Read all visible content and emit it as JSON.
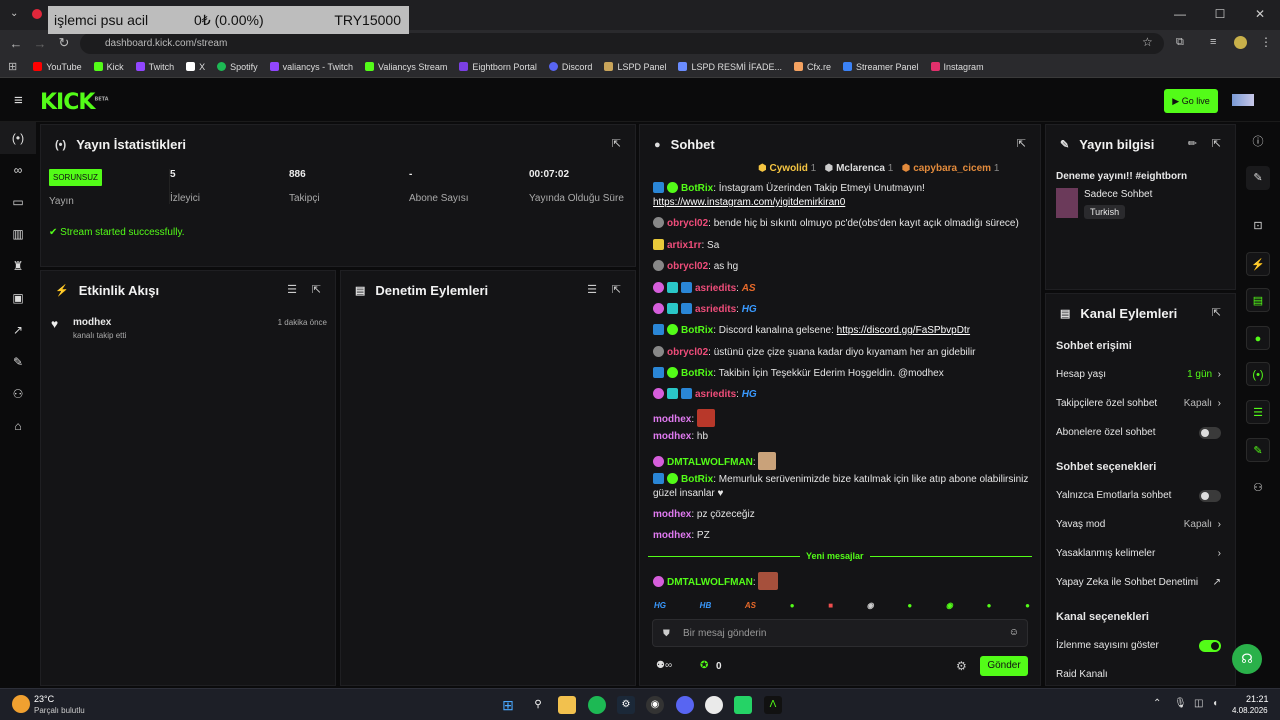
{
  "browser": {
    "donation_overlay": {
      "message": "işlemci psu acil",
      "amount": "0₺ (0.00%)",
      "goal": "TRY15000"
    },
    "url": "dashboard.kick.com/stream",
    "bookmarks": [
      "YouTube",
      "Kick",
      "Twitch",
      "X",
      "Spotify",
      "valiancys - Twitch",
      "Valiancys Stream",
      "Eightborn Portal",
      "Discord",
      "LSPD Panel",
      "LSPD  RESMİ İFADE...",
      "Cfx.re",
      "Streamer Panel",
      "Instagram"
    ],
    "bookmark_colors": [
      "#ff0000",
      "#53fc18",
      "#9146ff",
      "#ffffff",
      "#1db954",
      "#9146ff",
      "#53fc18",
      "#7b3fe4",
      "#5865f2",
      "#c8a45a",
      "#6a8cff",
      "#f4a261",
      "#3b82f6",
      "#e1306c"
    ]
  },
  "header": {
    "logo": "KICK",
    "beta": "BETA",
    "go_live": "Go live"
  },
  "stats": {
    "title": "Yayın İstatistikleri",
    "status_badge": "SORUNSUZ",
    "items": [
      {
        "value": "",
        "label": "Yayın"
      },
      {
        "value": "5",
        "label": "İzleyici"
      },
      {
        "value": "886",
        "label": "Takipçi"
      },
      {
        "value": "-",
        "label": "Abone Sayısı"
      },
      {
        "value": "00:07:02",
        "label": "Yayında Olduğu Süre"
      }
    ],
    "success": "Stream started successfully."
  },
  "activity": {
    "title": "Etkinlik Akışı",
    "user": "modhex",
    "action": "kanalı takip etti",
    "time": "1 dakika önce"
  },
  "moderation": {
    "title": "Denetim Eylemleri"
  },
  "chat": {
    "title": "Sohbet",
    "top_gifters": [
      {
        "name": "Cywolid",
        "count": "1"
      },
      {
        "name": "Mclarenca",
        "count": "1"
      },
      {
        "name": "capybara_cicem",
        "count": "1"
      }
    ],
    "messages": [
      {
        "user": "BotRix",
        "text": "İnstagram Üzerinden Takip Etmeyi Unutmayın!",
        "line2": "https://www.instagram.com/yigitdemirkiran0"
      },
      {
        "user": "obrycl02",
        "text": "bende hiç bi sıkıntı olmuyo pc'de(obs'den kayıt açık olmadığı sürece)"
      },
      {
        "user": "artix1rr",
        "text": "Sa"
      },
      {
        "user": "obrycl02",
        "text": "as hg"
      },
      {
        "user": "asriedits",
        "text": "AS"
      },
      {
        "user": "asriedits",
        "text": "HG"
      },
      {
        "user": "BotRix",
        "text": "Discord kanalına gelsene: ",
        "link": "https://discord.gg/FaSPbvpDtr"
      },
      {
        "user": "obrycl02",
        "text": "üstünü çize çize şuana kadar diyo kıyamam her an gidebilir"
      },
      {
        "user": "BotRix",
        "text": "Takibin İçin Teşekkür Ederim Hoşgeldin. @modhex"
      },
      {
        "user": "asriedits",
        "text": "HG"
      },
      {
        "user": "modhex",
        "text": ""
      },
      {
        "user": "modhex",
        "text": "hb"
      },
      {
        "user": "DMTALWOLFMAN",
        "text": ""
      },
      {
        "user": "BotRix",
        "text": "Memurluk serüvenimizde bize katılmak için like atıp abone olabilirsiniz",
        "line2": "güzel insanlar ♥"
      },
      {
        "user": "modhex",
        "text": "pz çözeceğiz"
      },
      {
        "user": "modhex",
        "text": "PZ"
      },
      {
        "user": "DMTALWOLFMAN",
        "text": ""
      }
    ],
    "new_messages": "Yeni mesajlar",
    "emote_row": [
      "HG",
      "HB",
      "AS"
    ],
    "placeholder": "Bir mesaj gönderin",
    "points": "0",
    "send": "Gönder"
  },
  "stream_info": {
    "title": "Yayın bilgisi",
    "stream_title": "Deneme yayını!! #eightborn",
    "category": "Sadece Sohbet",
    "tag": "Turkish"
  },
  "channel_actions": {
    "title": "Kanal Eylemleri",
    "chat_access": "Sohbet erişimi",
    "account_age": {
      "label": "Hesap yaşı",
      "value": "1 gün"
    },
    "followers_only": {
      "label": "Takipçilere özel sohbet",
      "value": "Kapalı"
    },
    "subs_only": {
      "label": "Abonelere özel sohbet",
      "enabled": false
    },
    "chat_options": "Sohbet seçenekleri",
    "emote_only": {
      "label": "Yalnızca Emotlarla sohbet",
      "enabled": false
    },
    "slow_mode": {
      "label": "Yavaş mod",
      "value": "Kapalı"
    },
    "banned_words": "Yasaklanmış kelimeler",
    "ai_moderation": "Yapay Zeka ile Sohbet Denetimi",
    "channel_options": "Kanal seçenekleri",
    "show_viewers": {
      "label": "İzlenme sayısını göster",
      "enabled": true
    },
    "raid": "Raid Kanalı"
  },
  "taskbar": {
    "temp": "23°C",
    "weather": "Parçalı bulutlu",
    "time": "21:21",
    "date": "4.08.2026"
  }
}
